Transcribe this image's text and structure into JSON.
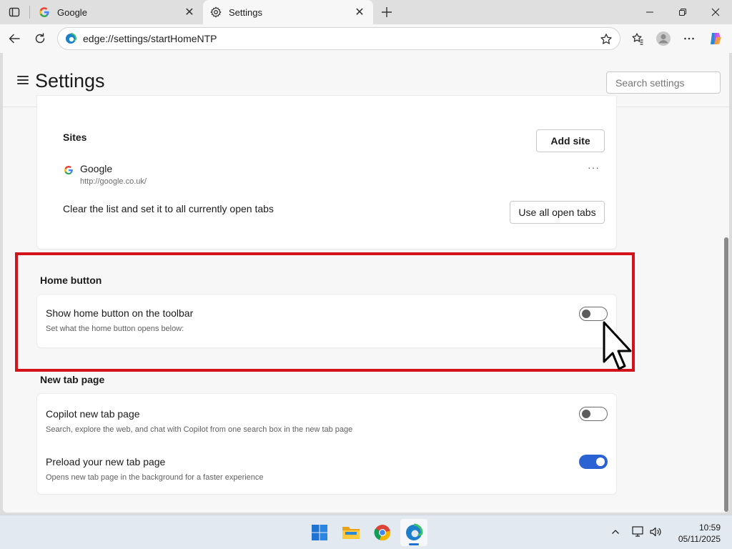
{
  "browser": {
    "tabs": [
      {
        "title": "Google",
        "icon": "google-g-icon",
        "active": false
      },
      {
        "title": "Settings",
        "icon": "gear-icon",
        "active": true
      }
    ],
    "address": "edge://settings/startHomeNTP"
  },
  "settings": {
    "title": "Settings",
    "search_placeholder": "Search settings",
    "sites": {
      "label": "Sites",
      "add_button": "Add site",
      "items": [
        {
          "name": "Google",
          "url": "http://google.co.uk/",
          "more": "···"
        }
      ],
      "clear_text": "Clear the list and set it to all currently open tabs",
      "use_all_button": "Use all open tabs"
    },
    "home_button": {
      "section_title": "Home button",
      "title": "Show home button on the toolbar",
      "description": "Set what the home button opens below:",
      "enabled": false
    },
    "new_tab_page": {
      "section_title": "New tab page",
      "rows": [
        {
          "title": "Copilot new tab page",
          "description": "Search, explore the web, and chat with Copilot from one search box in the new tab page",
          "enabled": false
        },
        {
          "title": "Preload your new tab page",
          "description": "Opens new tab page in the background for a faster experience",
          "enabled": true
        }
      ]
    }
  },
  "taskbar": {
    "apps": [
      "windows-start-icon",
      "file-explorer-icon",
      "chrome-icon",
      "edge-icon"
    ],
    "time": "10:59",
    "date": "05/11/2025"
  },
  "colors": {
    "highlight": "#d3121a",
    "toggle_on": "#2a62d3"
  }
}
